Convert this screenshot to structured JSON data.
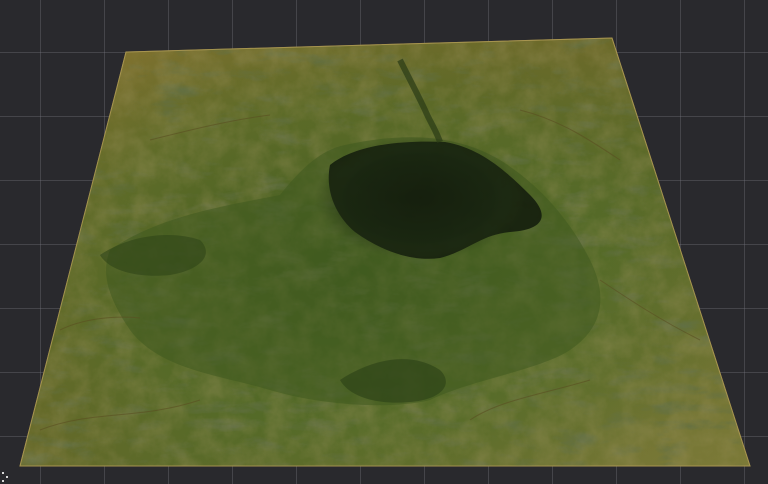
{
  "viewport": {
    "background_color": "#29292d",
    "grid_color": "#78787f",
    "object": "terrain-heightmap-mesh"
  },
  "terrain": {
    "base_color": "#7a6a2c",
    "highlight_color": "#a88f4a",
    "vegetation_color": "#4c6a26",
    "shadow_color": "#1f2a12",
    "crater_color": "#182210"
  },
  "icons": {
    "axis_gizmo": "axis-gizmo-icon"
  }
}
